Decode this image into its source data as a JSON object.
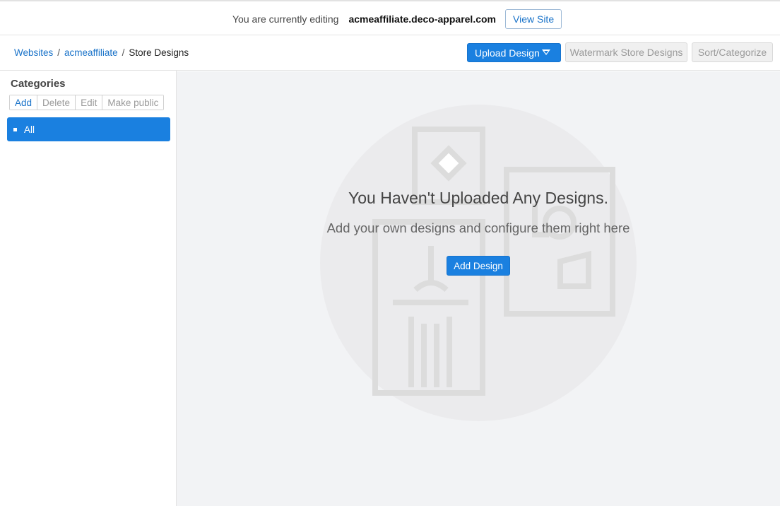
{
  "topbar": {
    "editing_text": "You are currently editing",
    "site_name": "acmeaffiliate.deco-apparel.com",
    "view_site_label": "View Site"
  },
  "breadcrumb": {
    "items": [
      "Websites",
      "acmeaffiliate"
    ],
    "separator": "/",
    "current": "Store Designs"
  },
  "toolbar": {
    "upload_label": "Upload Design",
    "watermark_label": "Watermark Store Designs",
    "sort_label": "Sort/Categorize"
  },
  "sidebar": {
    "title": "Categories",
    "tools": [
      "Add",
      "Delete",
      "Edit",
      "Make public"
    ],
    "items": [
      {
        "label": "All",
        "selected": true
      }
    ]
  },
  "empty_state": {
    "title": "You Haven't Uploaded Any Designs.",
    "subtitle": "Add your own designs and configure them right here",
    "button_label": "Add Design"
  },
  "colors": {
    "accent": "#1a80e0",
    "link": "#1a73c9",
    "main_bg": "#f2f3f5",
    "illustration": "#dcdcdc"
  }
}
